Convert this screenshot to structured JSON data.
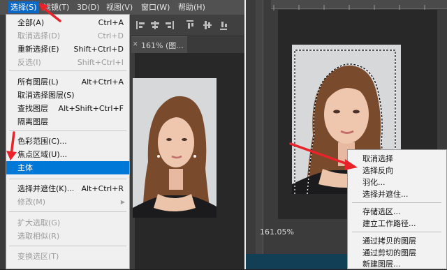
{
  "left": {
    "menubar": [
      {
        "label": "选择(S)",
        "active": true
      },
      {
        "label": "滤镜(T)"
      },
      {
        "label": "3D(D)"
      },
      {
        "label": "视图(V)"
      },
      {
        "label": "窗口(W)"
      },
      {
        "label": "帮助(H)"
      }
    ],
    "doc_tab": "161% (图...",
    "select_menu": {
      "items": [
        {
          "label": "全部(A)",
          "shortcut": "Ctrl+A",
          "enabled": true
        },
        {
          "label": "取消选择(D)",
          "shortcut": "Ctrl+D",
          "enabled": false
        },
        {
          "label": "重新选择(E)",
          "shortcut": "Shift+Ctrl+D",
          "enabled": true
        },
        {
          "label": "反选(I)",
          "shortcut": "Shift+Ctrl+I",
          "enabled": false
        },
        {
          "label": "所有图层(L)",
          "shortcut": "Alt+Ctrl+A",
          "enabled": true
        },
        {
          "label": "取消选择图层(S)",
          "shortcut": "",
          "enabled": true
        },
        {
          "label": "查找图层",
          "shortcut": "Alt+Shift+Ctrl+F",
          "enabled": true
        },
        {
          "label": "隔离图层",
          "shortcut": "",
          "enabled": true
        },
        {
          "label": "色彩范围(C)...",
          "shortcut": "",
          "enabled": true
        },
        {
          "label": "焦点区域(U)...",
          "shortcut": "",
          "enabled": true
        },
        {
          "label": "主体",
          "shortcut": "",
          "enabled": true,
          "highlighted": true
        },
        {
          "label": "选择并遮住(K)...",
          "shortcut": "Alt+Ctrl+R",
          "enabled": true
        },
        {
          "label": "修改(M)",
          "shortcut": "",
          "enabled": false,
          "submenu": true
        },
        {
          "label": "扩大选取(G)",
          "shortcut": "",
          "enabled": false
        },
        {
          "label": "选取相似(R)",
          "shortcut": "",
          "enabled": false
        },
        {
          "label": "变换选区(T)",
          "shortcut": "",
          "enabled": false
        }
      ]
    }
  },
  "right": {
    "zoom": "161.05%",
    "context_menu": {
      "items": [
        {
          "label": "取消选择"
        },
        {
          "label": "选择反向"
        },
        {
          "label": "羽化..."
        },
        {
          "label": "选择并遮住..."
        },
        {
          "label": "存储选区..."
        },
        {
          "label": "建立工作路径..."
        },
        {
          "label": "通过拷贝的图层"
        },
        {
          "label": "通过剪切的图层"
        },
        {
          "label": "新建图层..."
        }
      ]
    }
  },
  "colors": {
    "highlight": "#0078d7",
    "menubar_active": "#0a69c6",
    "annotation_arrow": "#e8232a"
  }
}
